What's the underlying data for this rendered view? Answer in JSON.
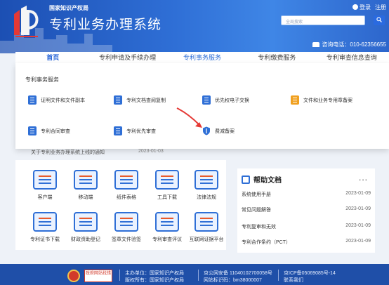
{
  "header": {
    "org_name": "国家知识产权局",
    "system_name": "专利业务办理系统",
    "login": "登录",
    "register": "注册",
    "search_placeholder": "全局搜索",
    "hotline": "咨询电话：010-62356655"
  },
  "nav": [
    {
      "label": "首页"
    },
    {
      "label": "专利申请及手续办理"
    },
    {
      "label": "专利事务服务"
    },
    {
      "label": "专利缴费服务"
    },
    {
      "label": "专利审查信息查询"
    }
  ],
  "dropdown": {
    "title": "专利事务服务",
    "items": [
      {
        "label": "证明文件和文件副本",
        "color": "#2f6fd6"
      },
      {
        "label": "专利文档查阅复制",
        "color": "#2f6fd6"
      },
      {
        "label": "优先权电子交换",
        "color": "#2f6fd6"
      },
      {
        "label": "文件和业务专用章备案",
        "color": "#f0a020"
      },
      {
        "label": "专利合同审查",
        "color": "#2f6fd6"
      },
      {
        "label": "专利优先审查",
        "color": "#2f6fd6"
      },
      {
        "label": "费减备案",
        "color": "#2f6fd6"
      }
    ]
  },
  "notice": {
    "text": "关于专利业务办理系统上线的通知",
    "date": "2023-01-03"
  },
  "tools": [
    {
      "label": "客户端",
      "icon": "client-icon"
    },
    {
      "label": "移动端",
      "icon": "mobile-icon"
    },
    {
      "label": "纸件表格",
      "icon": "paper-form-icon"
    },
    {
      "label": "工具下载",
      "icon": "tool-download-icon"
    },
    {
      "label": "法律法规",
      "icon": "law-icon"
    },
    {
      "label": "专利证书下载",
      "icon": "certificate-icon"
    },
    {
      "label": "财政资助登记",
      "icon": "finance-icon"
    },
    {
      "label": "签章文件验签",
      "icon": "signature-icon"
    },
    {
      "label": "专利审查评议",
      "icon": "review-icon"
    },
    {
      "label": "互联网证据平台",
      "icon": "evidence-icon"
    }
  ],
  "help": {
    "title": "帮助文档",
    "more": "...",
    "items": [
      {
        "label": "系统使用手册",
        "date": "2023-01-09"
      },
      {
        "label": "常见问题解答",
        "date": "2023-01-09"
      },
      {
        "label": "专利复审和无效",
        "date": "2023-01-09"
      },
      {
        "label": "专利合作条约（PCT）",
        "date": "2023-01-09"
      }
    ]
  },
  "footer": {
    "badge": "政府网站找错",
    "sponsor": "主办单位：国家知识产权局",
    "copyright": "版权所有：国家知识产权局",
    "police": "京公网安备 11040102700058号",
    "site_code": "网站标识码：bm38000007",
    "icp": "京ICP备05069085号-14",
    "contact": "联系我们"
  },
  "colors": {
    "primary": "#2f6fd6",
    "header_dark": "#1c4fb3",
    "footer": "#1f4fa8",
    "accent_red": "#e53935"
  }
}
